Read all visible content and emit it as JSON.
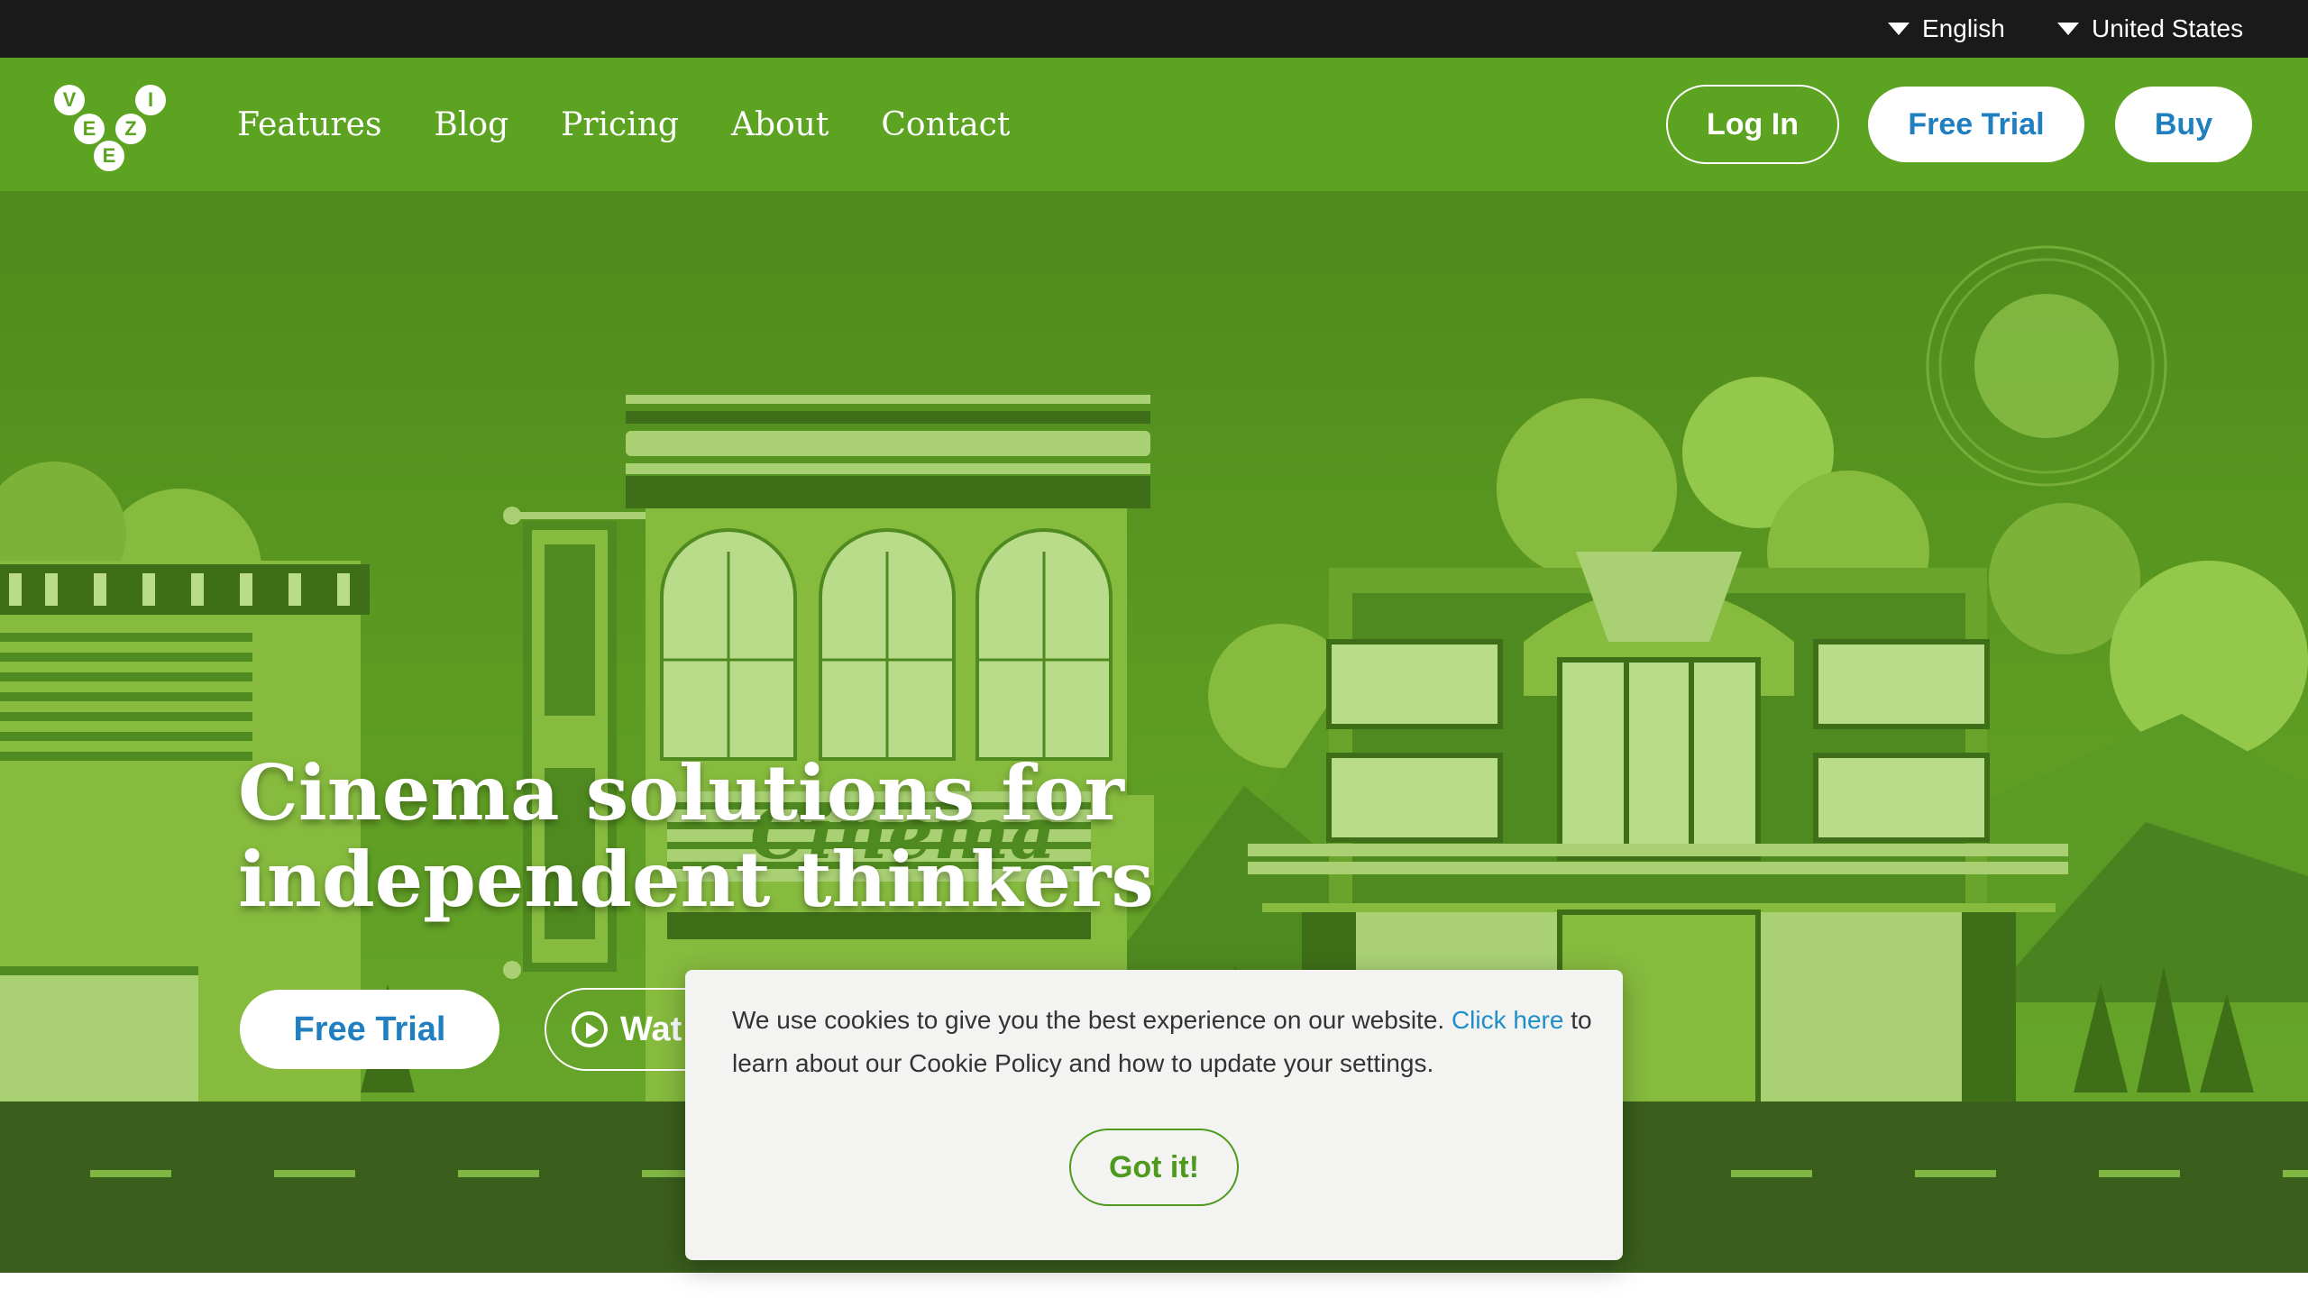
{
  "topbar": {
    "language": "English",
    "country": "United States"
  },
  "nav": {
    "logo_letters": [
      "V",
      "E",
      "Z",
      "I",
      "E"
    ],
    "links": [
      "Features",
      "Blog",
      "Pricing",
      "About",
      "Contact"
    ],
    "login_label": "Log In",
    "free_trial_label": "Free Trial",
    "buy_label": "Buy"
  },
  "hero": {
    "headline": "Cinema solutions for independent thinkers",
    "sign_text": "Cinema",
    "free_trial_label": "Free Trial",
    "watch_label": "Wat"
  },
  "cookie": {
    "text_before": "We use cookies to give you the best experience on our website. ",
    "link_text": "Click here",
    "text_after": " to learn about our Cookie Policy and how to update your settings.",
    "button_label": "Got it!"
  },
  "colors": {
    "topbar": "#1a1a1a",
    "nav": "#5da322",
    "accent_blue": "#1f7fc0",
    "cookie_bg": "#f3f3f1",
    "cookie_button": "#4d9a1e"
  }
}
